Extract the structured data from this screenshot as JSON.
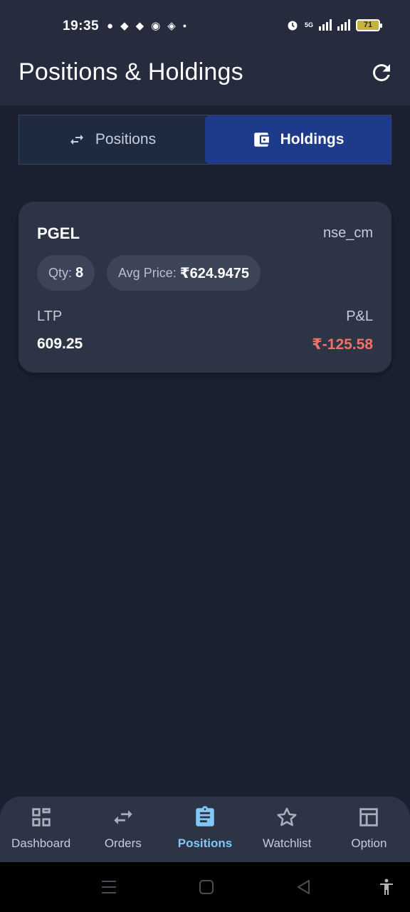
{
  "status_bar": {
    "time": "19:35",
    "network_label": "5G",
    "battery": "71"
  },
  "app_bar": {
    "title": "Positions & Holdings"
  },
  "tabs": [
    {
      "label": "Positions",
      "active": false
    },
    {
      "label": "Holdings",
      "active": true
    }
  ],
  "holding": {
    "symbol": "PGEL",
    "exchange": "nse_cm",
    "qty_label": "Qty:",
    "qty": "8",
    "avg_label": "Avg Price:",
    "avg_price": "₹624.9475",
    "ltp_label": "LTP",
    "ltp": "609.25",
    "pnl_label": "P&L",
    "pnl": "₹-125.58"
  },
  "bottom_nav": [
    {
      "label": "Dashboard",
      "icon": "dashboard-icon"
    },
    {
      "label": "Orders",
      "icon": "swap-icon"
    },
    {
      "label": "Positions",
      "icon": "clipboard-icon",
      "active": true
    },
    {
      "label": "Watchlist",
      "icon": "star-icon"
    },
    {
      "label": "Option",
      "icon": "table-icon"
    }
  ],
  "colors": {
    "background": "#1c2131",
    "card": "#2d3446",
    "active_tab": "#1e3a8a",
    "active_nav": "#7fc8f5",
    "loss": "#f07167"
  }
}
